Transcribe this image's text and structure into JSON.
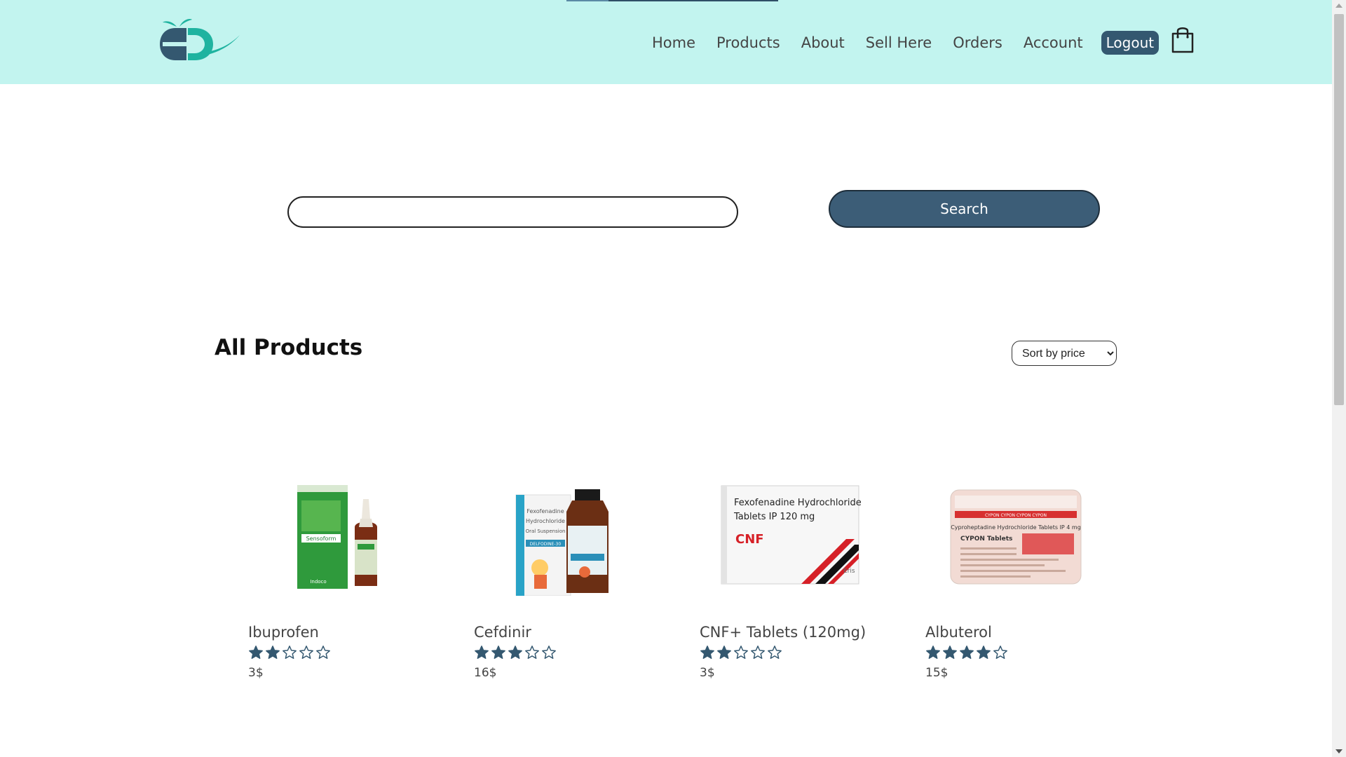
{
  "brand": {
    "accent": "#345870",
    "header_bg": "#c2f4ef"
  },
  "nav": {
    "items": [
      {
        "label": "Home"
      },
      {
        "label": "Products"
      },
      {
        "label": "About"
      },
      {
        "label": "Sell Here"
      },
      {
        "label": "Orders"
      },
      {
        "label": "Account"
      }
    ],
    "logout_label": "Logout"
  },
  "search": {
    "value": "",
    "placeholder": "",
    "button_label": "Search"
  },
  "section": {
    "title": "All Products",
    "sort": {
      "selected": "Sort by price"
    }
  },
  "products": [
    {
      "name": "Ibuprofen",
      "rating": 2,
      "max_rating": 5,
      "price": "3$"
    },
    {
      "name": "Cefdinir",
      "rating": 3,
      "max_rating": 5,
      "price": "16$"
    },
    {
      "name": "CNF+ Tablets (120mg)",
      "rating": 2,
      "max_rating": 5,
      "price": "3$"
    },
    {
      "name": "Albuterol",
      "rating": 4,
      "max_rating": 5,
      "price": "15$"
    }
  ],
  "product_images": {
    "p1": {
      "brand_text": "Sensoform",
      "maker_text": "Indoco"
    },
    "p2": {
      "line1": "Fexofenadine",
      "line2": "Hydrochloride",
      "line3": "Oral Suspension",
      "brand_text": "DELFODINE-30"
    },
    "p3": {
      "line1": "Fexofenadine Hydrochloride",
      "line2": "Tablets IP 120 mg",
      "brand_text": "CNF",
      "maker_text": "Eris"
    },
    "p4": {
      "line1": "Cyproheptadine Hydrochloride Tablets IP 4 mg",
      "brand_text": "CYPON Tablets",
      "band_text": "CYPON  CYPON  CYPON  CYPON"
    }
  },
  "icons": {
    "logo": "pharmacy-logo-icon",
    "cart": "shopping-bag-icon",
    "star_filled": "star-filled-icon",
    "star_empty": "star-outline-icon"
  }
}
